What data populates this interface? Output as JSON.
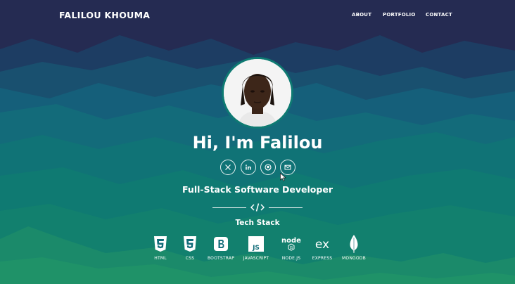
{
  "brand": "FALILOU KHOUMA",
  "nav": {
    "about": "ABOUT",
    "portfolio": "PORTFOLIO",
    "contact": "CONTACT"
  },
  "hero": {
    "greeting": "Hi, I'm Falilou",
    "role": "Full-Stack Software Developer",
    "stack_title": "Tech Stack"
  },
  "socials": [
    {
      "icon": "x-icon"
    },
    {
      "icon": "linkedin-icon"
    },
    {
      "icon": "github-icon"
    },
    {
      "icon": "mail-icon"
    }
  ],
  "tech_stack": [
    {
      "label": "HTML",
      "icon": "html5-icon"
    },
    {
      "label": "CSS",
      "icon": "css3-icon"
    },
    {
      "label": "BOOTSTRAP",
      "icon": "bootstrap-icon"
    },
    {
      "label": "JAVASCRIPT",
      "icon": "javascript-icon"
    },
    {
      "label": "NODE.JS",
      "icon": "nodejs-icon",
      "logo_text": "node"
    },
    {
      "label": "EXPRESS",
      "icon": "express-icon",
      "logo_text": "ex"
    },
    {
      "label": "MONGODB",
      "icon": "mongodb-icon"
    }
  ],
  "colors": {
    "background_top": "#23294f",
    "background_mid": "#0f5f78",
    "background_bottom": "#1b8a6a",
    "avatar_ring": "#0e7a72"
  }
}
